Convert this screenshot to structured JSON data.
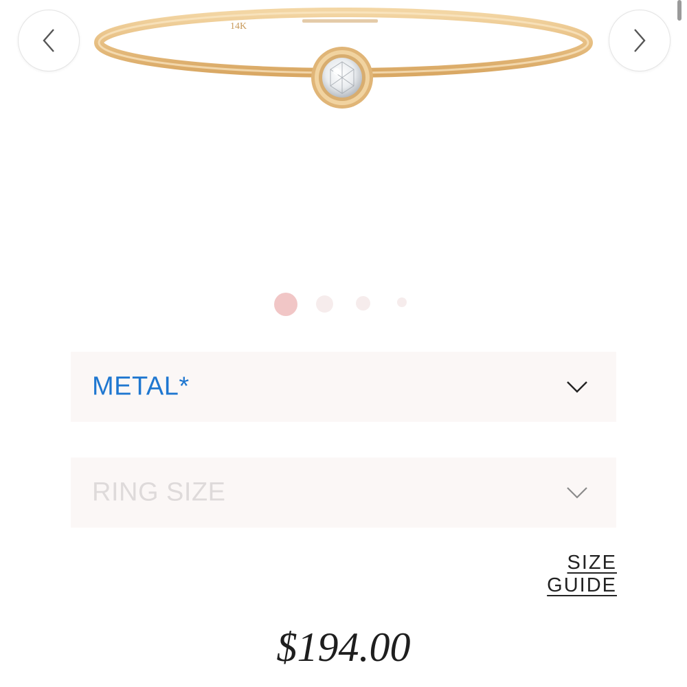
{
  "product": {
    "image_icon": "ring-image",
    "engraving": "14K",
    "price": "$194.00"
  },
  "gallery": {
    "prev_icon": "chevron-left-icon",
    "next_icon": "chevron-right-icon",
    "dot_count": 4,
    "active_dot": 1,
    "colors": {
      "active_dot": "#f1c6c6",
      "inactive_dot": "#f6ecec"
    }
  },
  "options": {
    "metal": {
      "label": "METAL*",
      "icon": "chevron-down-icon",
      "color": "#1f77d0"
    },
    "ring_size": {
      "label": "RING SIZE",
      "icon": "chevron-down-icon",
      "color": "#dedada"
    },
    "size_guide": "SIZE GUIDE"
  }
}
